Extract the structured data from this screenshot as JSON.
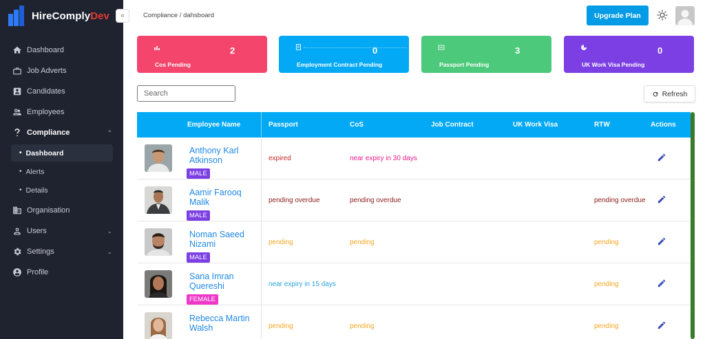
{
  "app": {
    "brand_name": "HireComply",
    "brand_suffix": "Dev"
  },
  "sidebar": {
    "items": [
      {
        "label": "Dashboard",
        "icon": "home-icon"
      },
      {
        "label": "Job Adverts",
        "icon": "briefcase-icon"
      },
      {
        "label": "Candidates",
        "icon": "candidate-icon"
      },
      {
        "label": "Employees",
        "icon": "people-icon"
      },
      {
        "label": "Compliance",
        "icon": "question-icon"
      },
      {
        "label": "Organisation",
        "icon": "building-icon"
      },
      {
        "label": "Users",
        "icon": "user-icon"
      },
      {
        "label": "Settings",
        "icon": "gear-icon"
      },
      {
        "label": "Profile",
        "icon": "profile-icon"
      }
    ],
    "compliance_sub": [
      {
        "label": "Dashboard"
      },
      {
        "label": "Alerts"
      },
      {
        "label": "Details"
      }
    ]
  },
  "header": {
    "breadcrumb": "Compliance / dahsboard",
    "upgrade_label": "Upgrade Plan"
  },
  "cards": [
    {
      "label": "Cos Pending",
      "value": "2",
      "color": "#f4456c"
    },
    {
      "label": "Employment Contract Pending",
      "value": "0",
      "color": "#03a9f4"
    },
    {
      "label": "Passport Pending",
      "value": "3",
      "color": "#4cc97a"
    },
    {
      "label": "UK Work Visa Pending",
      "value": "0",
      "color": "#7b3fe4"
    }
  ],
  "toolbar": {
    "search_placeholder": "Search",
    "refresh_label": "Refresh"
  },
  "table": {
    "columns": [
      "Employee Name",
      "Passport",
      "CoS",
      "Job Contract",
      "UK Work Visa",
      "RTW",
      "Actions"
    ],
    "rows": [
      {
        "name": "Anthony Karl Atkinson",
        "gender": "MALE",
        "passport": "expired",
        "cos": "near expiry in 30 days",
        "job_contract": "",
        "uk_work_visa": "",
        "rtw": ""
      },
      {
        "name": "Aamir Farooq Malik",
        "gender": "MALE",
        "passport": "pending overdue",
        "cos": "pending overdue",
        "job_contract": "",
        "uk_work_visa": "",
        "rtw": "pending overdue"
      },
      {
        "name": "Noman Saeed Nizami",
        "gender": "MALE",
        "passport": "pending",
        "cos": "pending",
        "job_contract": "",
        "uk_work_visa": "",
        "rtw": "pending"
      },
      {
        "name": "Sana Imran Quereshi",
        "gender": "FEMALE",
        "passport": "near expiry in 15 days",
        "cos": "",
        "job_contract": "",
        "uk_work_visa": "",
        "rtw": "pending"
      },
      {
        "name": "Rebecca Martin Walsh",
        "gender": "",
        "passport": "pending",
        "cos": "pending",
        "job_contract": "",
        "uk_work_visa": "",
        "rtw": "pending"
      }
    ]
  },
  "colors": {
    "sidebar_bg": "#1f2330",
    "accent": "#03a9f4",
    "male_badge": "#7b3fe4",
    "female_badge": "#f038c8"
  }
}
